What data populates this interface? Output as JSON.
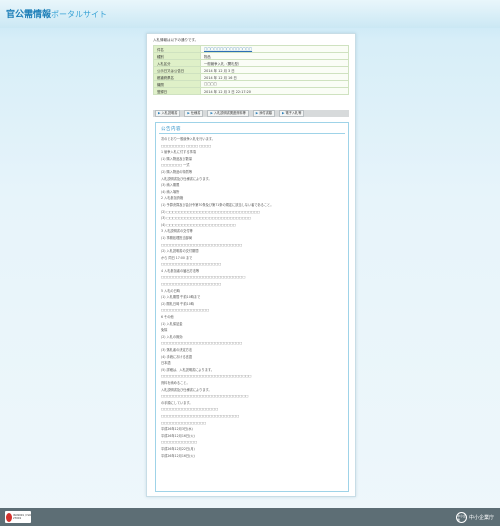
{
  "header": {
    "title": "官公需情報",
    "subtitle": "ポータルサイト"
  },
  "intro": "入札情報は以下の通りです。",
  "info": [
    {
      "k": "件名",
      "v": "□□□□□□□□□□□□□□□",
      "link": true
    },
    {
      "k": "種別",
      "v": "物品",
      "link": false
    },
    {
      "k": "入札区分",
      "v": "一般競争入札（開札型）",
      "link": false
    },
    {
      "k": "公示日又は公告日",
      "v": "2014 年 12 月 3 日",
      "link": false
    },
    {
      "k": "都道府県名",
      "v": "2014 年 12 月 16 日",
      "link": false
    },
    {
      "k": "機関",
      "v": "□□□□",
      "link": false
    },
    {
      "k": "登録日",
      "v": "2014 年 12 月 3 日 22:17:20",
      "link": false
    }
  ],
  "tabs": [
    "入札説明書",
    "仕様書",
    "入札説明書関連資料等",
    "添付書類",
    "電子入札等"
  ],
  "notice": {
    "title": "公告内容",
    "lines": [
      "次のとおり一般競争入札を行います。",
      "□□□□□□□□ □□□□ □□□□",
      "1 競争入札に付する事項",
      "(1) 購入物品及び数量",
      "□□□□□□□ 一式",
      "(2) 購入物品の特質等",
      "入札説明書及び仕様書によります。",
      "(3) 納入期限",
      "(4) 納入場所",
      "2 入札参加資格",
      "(1) 予算決算及び会計令第70条及び第71条の規定に該当しない者であること。",
      "(2) □□□□□□□□□□□□□□□□□□□□□□□□□□□□□□□",
      "(3) □□□□□□□□□□□□□□□□□□□□□□□□□□□□",
      "(4) □□□□□□□□□□□□□□□□□□□□□□□",
      "3 入札説明書の交付等",
      "(1) 事務処理担当部局",
      "□□□□□□□□□□□□□□□□□□□□□□□□□□□",
      "(2) 入札説明書の交付期間",
      "から 同日 17:00 まで",
      "□□□□□□□□□□□□□□□□□□□□",
      "4 入札参加者の届出方法等",
      "□□□□□□□□□□□□□□□□□□□□□□□□□□□□",
      "□□□□□□□□□□□□□□□□□□□□",
      "5 入札の日時",
      "(1) 入札期間 午前10時まで",
      "(2) 開札日時 午前10時",
      "□□□□□□□□□□□□□□□□",
      "6 その他",
      "(1) 入札保証金",
      "免除",
      "(2) 入札の無効",
      "□□□□□□□□□□□□□□□□□□□□□□□□□□□",
      "(3) 落札者の決定方法",
      "(4) 手続における言語",
      "日本語",
      "(5) 詳細は、入札説明書によります。",
      "□□□□□□□□□□□□□□□□□□□□□□□□□□□□□□",
      "資料を納めること。",
      "入札説明書及び仕様書によります。",
      "□□□□□□□□□□□□□□□□□□□□□□□□□□□□□",
      "の手順にしています。",
      "□□□□□□□□□□□□□□□□□□□",
      "□□□□□□□□□□□□□□□□□□□□□□□□□□",
      "□□□□□□□□□□□□□□□",
      "平成26年12月3日(水)",
      "平成26年12月16日(火)",
      "□□□□□□□□□□□□",
      "平成26年12月22日(月)",
      "平成26年12月16日(火)"
    ]
  },
  "footer": {
    "badge_text": "ISO9001 / ISO 27001",
    "agency": "中小企業庁",
    "seal_text": "中小企業"
  }
}
